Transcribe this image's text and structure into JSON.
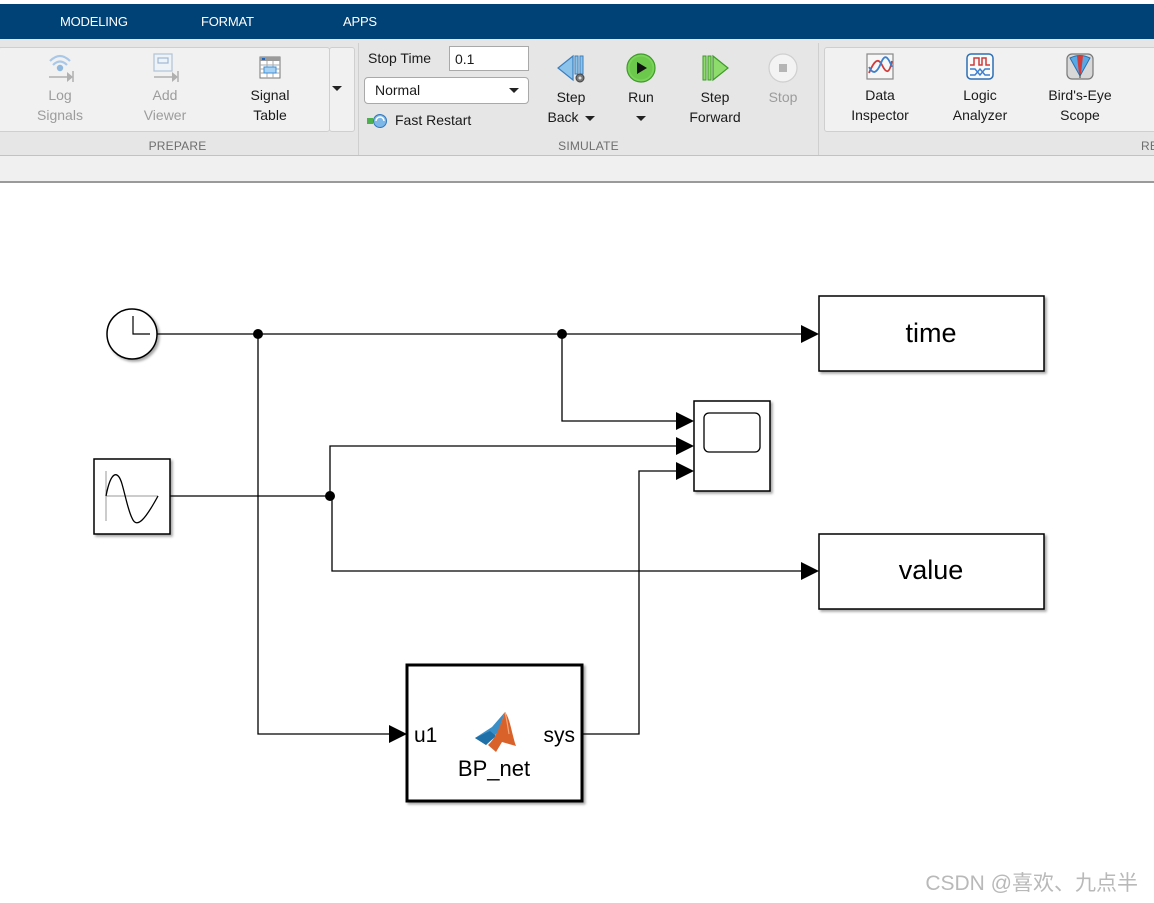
{
  "tabs": [
    {
      "label": "MODELING"
    },
    {
      "label": "FORMAT"
    },
    {
      "label": "APPS"
    }
  ],
  "ribbon": {
    "prepare": {
      "title": "PREPARE",
      "buttons": [
        {
          "line1": "Log",
          "line2": "Signals",
          "icon": "log-signals-icon",
          "enabled": false
        },
        {
          "line1": "Add",
          "line2": "Viewer",
          "icon": "add-viewer-icon",
          "enabled": false
        },
        {
          "line1": "Signal",
          "line2": "Table",
          "icon": "signal-table-icon",
          "enabled": true
        }
      ]
    },
    "simulate": {
      "title": "SIMULATE",
      "stop_time_label": "Stop Time",
      "stop_time_value": "0.1",
      "mode_value": "Normal",
      "fast_restart_label": "Fast Restart",
      "buttons": [
        {
          "line1": "Step",
          "line2": "Back",
          "icon": "step-back-icon",
          "enabled": true,
          "dropdown": true
        },
        {
          "line1": "Run",
          "line2": "",
          "icon": "run-icon",
          "enabled": true,
          "dropdown": true
        },
        {
          "line1": "Step",
          "line2": "Forward",
          "icon": "step-forward-icon",
          "enabled": true
        },
        {
          "line1": "Stop",
          "line2": "",
          "icon": "stop-icon",
          "enabled": false
        }
      ],
      "colors": {
        "run": "#3fae2a",
        "step": "#5ea7de"
      }
    },
    "review": {
      "title": "RE",
      "buttons": [
        {
          "line1": "Data",
          "line2": "Inspector",
          "icon": "data-inspector-icon"
        },
        {
          "line1": "Logic",
          "line2": "Analyzer",
          "icon": "logic-analyzer-icon"
        },
        {
          "line1": "Bird's-Eye",
          "line2": "Scope",
          "icon": "birds-eye-scope-icon"
        }
      ]
    }
  },
  "diagram": {
    "blocks": {
      "clock": {
        "type": "Clock"
      },
      "sine": {
        "type": "Sine Wave"
      },
      "scope": {
        "type": "Scope",
        "inputs": 3
      },
      "time_out": {
        "label": "time",
        "type": "To Workspace"
      },
      "value_out": {
        "label": "value",
        "type": "To Workspace"
      },
      "bp_net": {
        "name": "BP_net",
        "input_port": "u1",
        "output_port": "sys",
        "type": "MATLAB Function"
      }
    }
  },
  "watermark": "CSDN @喜欢、九点半"
}
